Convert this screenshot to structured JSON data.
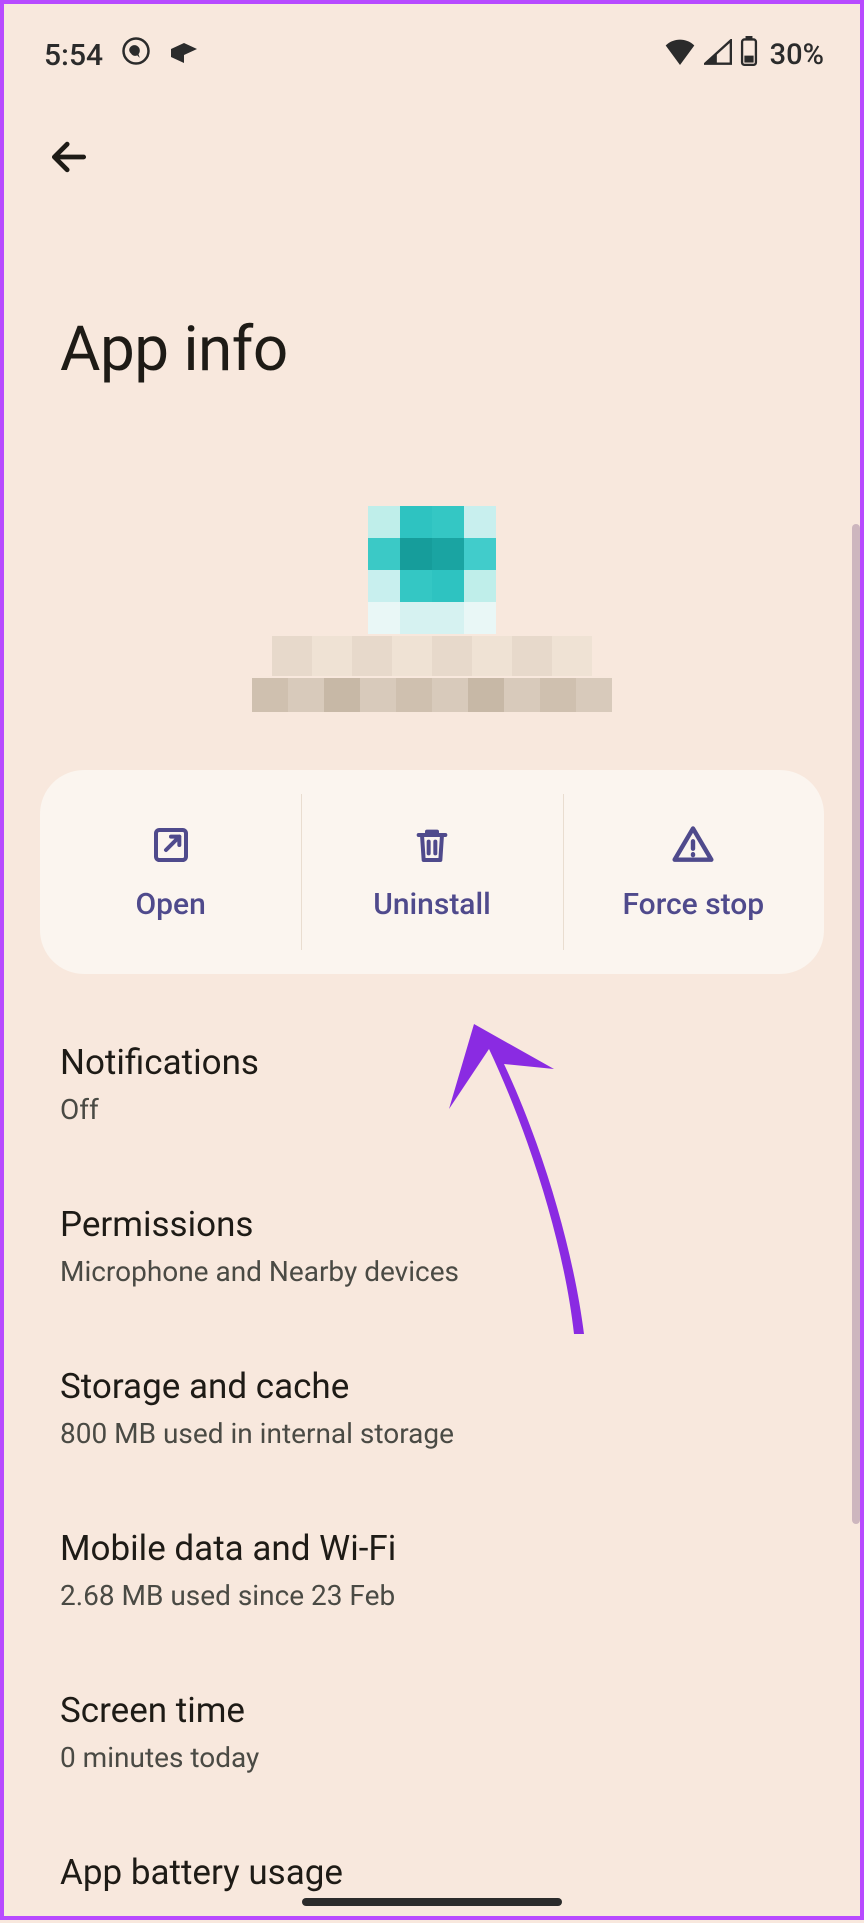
{
  "status": {
    "time": "5:54",
    "battery_pct": "30%"
  },
  "page": {
    "title": "App info"
  },
  "actions": {
    "open": "Open",
    "uninstall": "Uninstall",
    "force_stop": "Force stop"
  },
  "rows": {
    "notifications": {
      "title": "Notifications",
      "sub": "Off"
    },
    "permissions": {
      "title": "Permissions",
      "sub": "Microphone and Nearby devices"
    },
    "storage": {
      "title": "Storage and cache",
      "sub": "800 MB used in internal storage"
    },
    "data": {
      "title": "Mobile data and Wi-Fi",
      "sub": "2.68 MB used since 23 Feb"
    },
    "screentime": {
      "title": "Screen time",
      "sub": "0 minutes today"
    },
    "battery": {
      "title": "App battery usage"
    }
  },
  "colors": {
    "accent": "#4f4a8c",
    "annotation": "#8a2be2"
  }
}
